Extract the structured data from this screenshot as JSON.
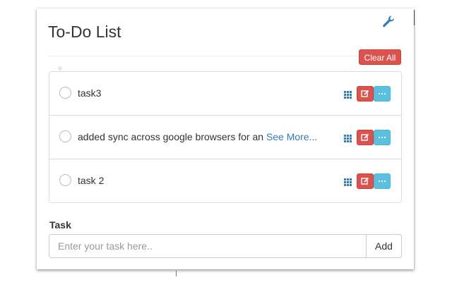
{
  "header": {
    "title": "To-Do List",
    "settings_icon": "wrench-icon"
  },
  "toolbar": {
    "clear_all_label": "Clear All"
  },
  "tasks": [
    {
      "text": "task3",
      "see_more": ""
    },
    {
      "text": "added sync across google browsers for an ",
      "see_more": "See More..."
    },
    {
      "text": "task 2",
      "see_more": ""
    }
  ],
  "row_icons": {
    "drag": "grid-drag-icon",
    "edit": "edit-icon",
    "more": "ellipsis-icon"
  },
  "form": {
    "label": "Task",
    "placeholder": "Enter your task here..",
    "value": "",
    "add_label": "Add"
  },
  "colors": {
    "danger": "#d9534f",
    "info": "#5bc0de",
    "link": "#337ab7",
    "wrench": "#337ab7",
    "text": "#333333"
  }
}
